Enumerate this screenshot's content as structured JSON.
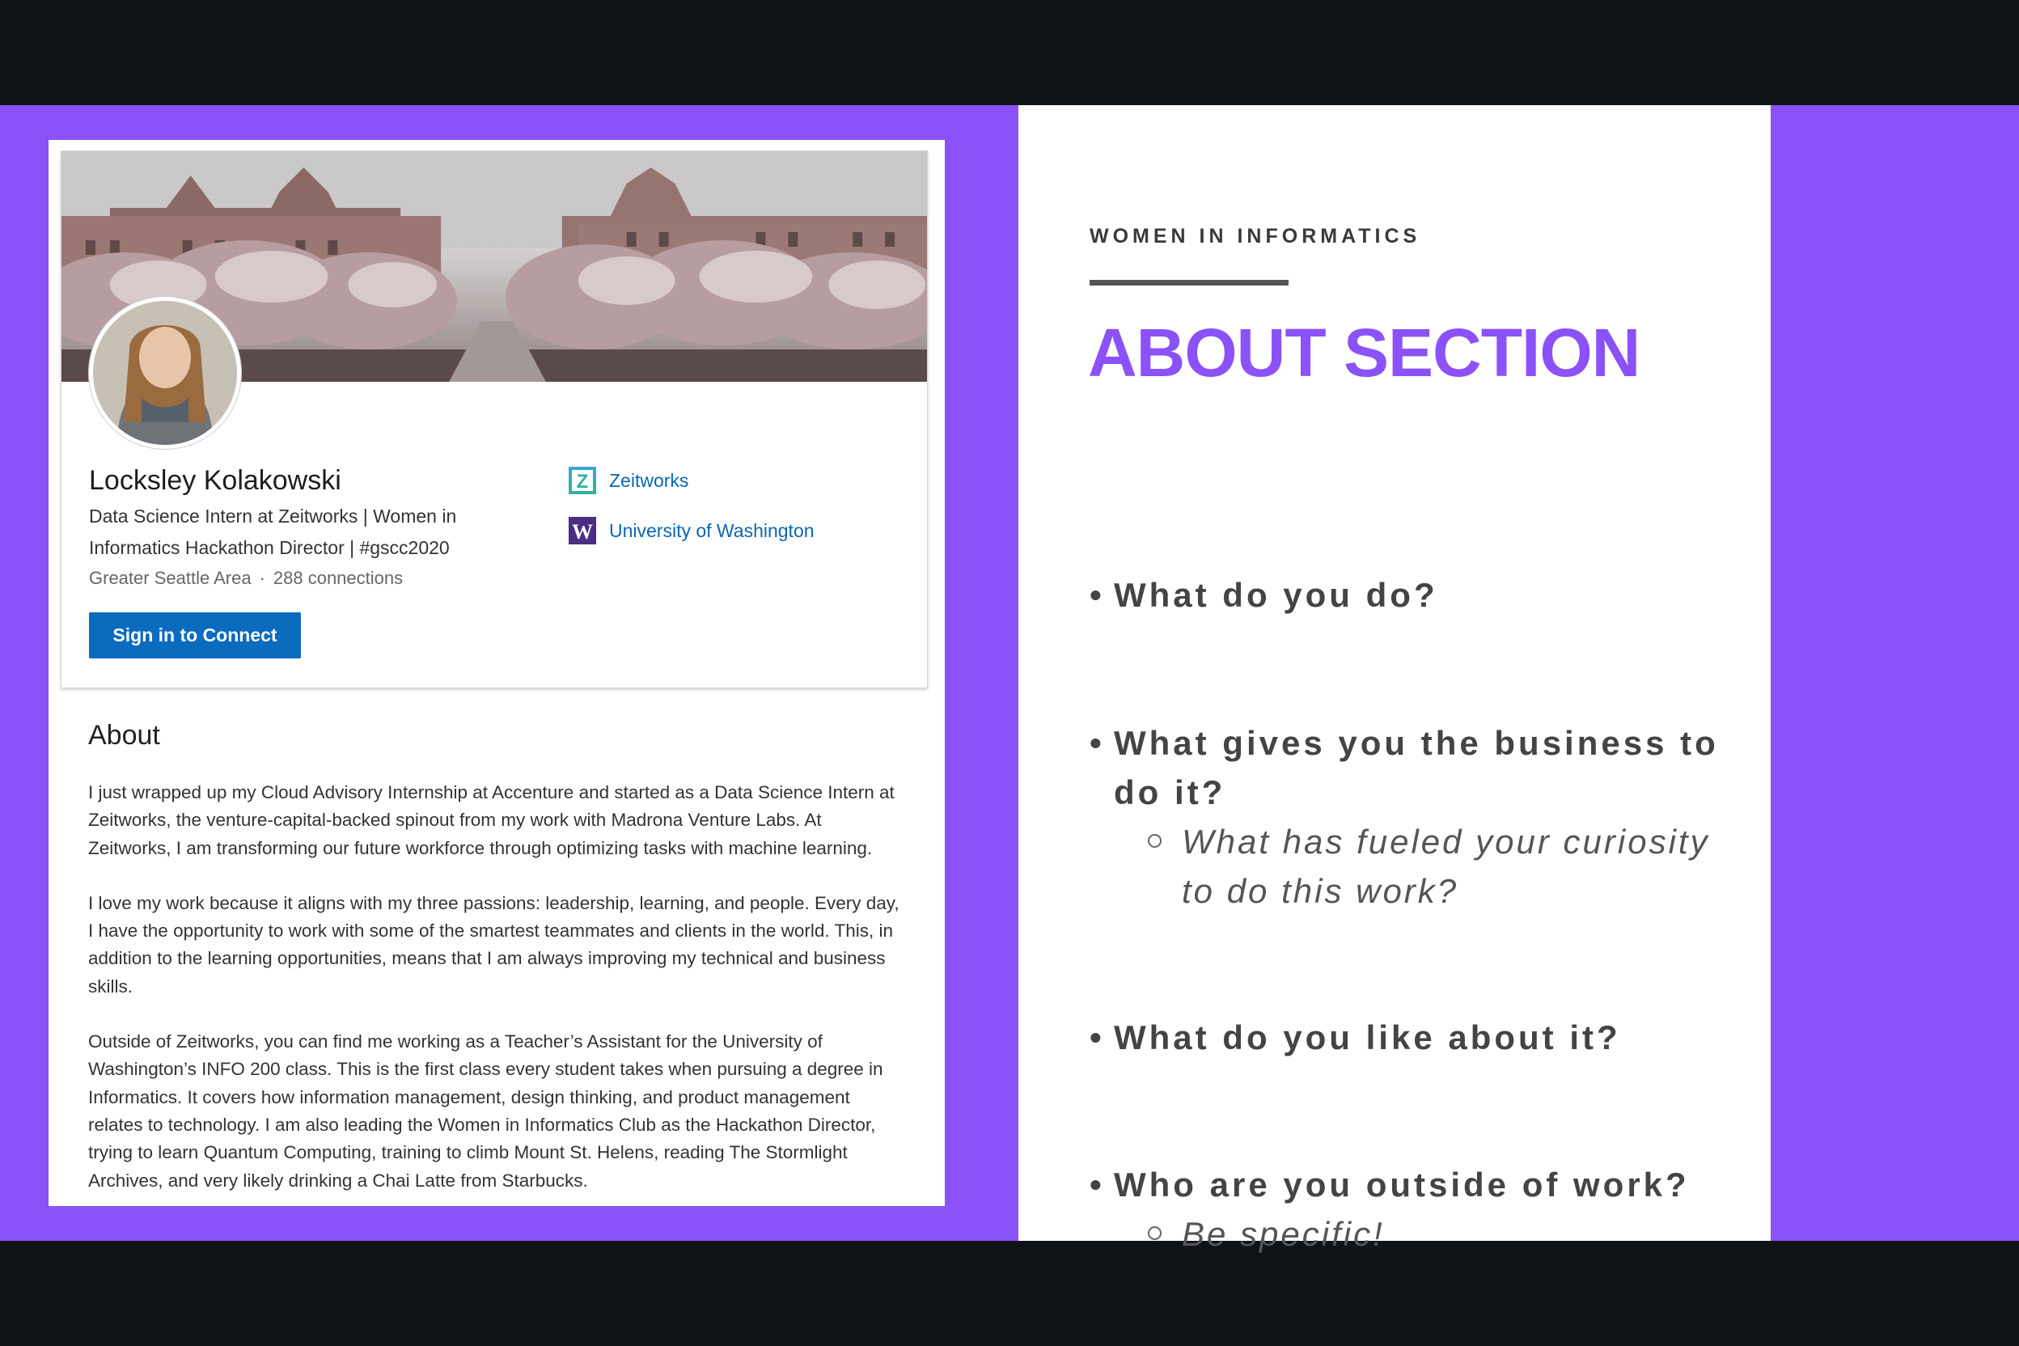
{
  "profile": {
    "name": "Locksley Kolakowski",
    "headline": "Data Science Intern at Zeitworks | Women in Informatics Hackathon Director | #gscc2020",
    "location": "Greater Seattle Area",
    "separator": "·",
    "connections": "288 connections",
    "connect_button": "Sign in to Connect",
    "orgs": [
      {
        "name": "Zeitworks",
        "logo_letter": "Z"
      },
      {
        "name": "University of Washington",
        "logo_letter": "W"
      }
    ]
  },
  "about": {
    "title": "About",
    "paragraphs": [
      "I just wrapped up my Cloud Advisory Internship at Accenture and started as a Data Science Intern at Zeitworks, the venture-capital-backed spinout from my work with Madrona Venture Labs. At Zeitworks, I am transforming our future workforce through optimizing tasks with machine learning.",
      "I love my work because it aligns with my three passions: leadership, learning, and people. Every day, I have the opportunity to work with some of the smartest teammates and clients in the world. This, in addition to the learning opportunities, means that I am always improving my technical and business skills.",
      "Outside of Zeitworks, you can find me working as a Teacher’s Assistant for the University of Washington’s INFO 200 class. This is the first class every student takes when pursuing a degree in Informatics. It covers how information management, design thinking, and product management relates to technology. I am also leading the Women in Informatics Club as the Hackathon Director, trying to learn Quantum Computing, training to climb Mount St. Helens, reading The Stormlight Archives, and very likely drinking a Chai Latte from Starbucks."
    ]
  },
  "slide": {
    "kicker": "WOMEN IN INFORMATICS",
    "title": "ABOUT SECTION",
    "bullet": "•",
    "questions": [
      {
        "text": "What do you do?"
      },
      {
        "text": "What gives you the business to do it?",
        "sub": "What has fueled your curiosity to do this work?"
      },
      {
        "text": "What do you like about it?"
      },
      {
        "text": "Who are you outside of work?",
        "sub": "Be specific!"
      }
    ]
  },
  "colors": {
    "accent": "#8a52f8",
    "frame": "#0f1318",
    "link": "#0b66b2",
    "button": "#0b6bbf"
  }
}
